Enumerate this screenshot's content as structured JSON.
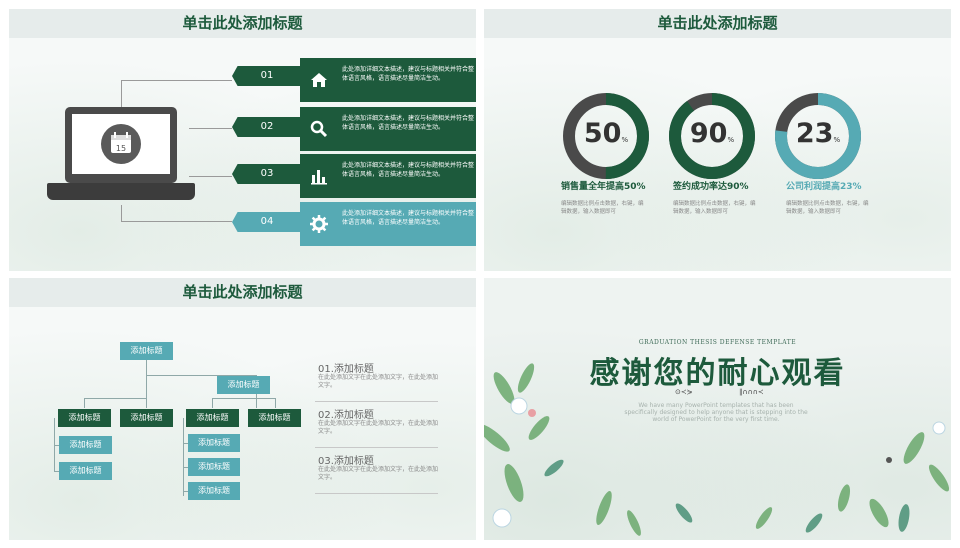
{
  "colors": {
    "dark_green": "#1d5a3c",
    "teal": "#56aab4",
    "gray_ring": "#4a4a4a",
    "title_bg": "#e6eceb"
  },
  "slide1": {
    "title": "单击此处添加标题",
    "laptop": {
      "icon": "calendar-icon",
      "day": "15"
    },
    "items": [
      {
        "num": "01",
        "icon": "house-icon",
        "text": "此处添加详细文本描述，建议与标题相关并符合整体语言风格，语言描述尽量简洁生动。",
        "color": "dark"
      },
      {
        "num": "02",
        "icon": "magnifier-icon",
        "text": "此处添加详细文本描述，建议与标题相关并符合整体语言风格，语言描述尽量简洁生动。",
        "color": "dark"
      },
      {
        "num": "03",
        "icon": "bar-chart-icon",
        "text": "此处添加详细文本描述，建议与标题相关并符合整体语言风格，语言描述尽量简洁生动。",
        "color": "dark"
      },
      {
        "num": "04",
        "icon": "gear-icon",
        "text": "此处添加详细文本描述，建议与标题相关并符合整体语言风格，语言描述尽量简洁生动。",
        "color": "teal"
      }
    ]
  },
  "slide2": {
    "title": "单击此处添加标题",
    "stats": [
      {
        "value": "50",
        "pct": "%",
        "progress": 0.5,
        "ring_color": "#1d5a3c",
        "label": "销售量全年提高50%",
        "desc": "编辑数据比例点击数据，右键，编辑数据，输入数据即可"
      },
      {
        "value": "90",
        "pct": "%",
        "progress": 0.9,
        "ring_color": "#1d5a3c",
        "label": "签约成功率达90%",
        "desc": "编辑数据比例点击数据，右键，编辑数据，输入数据即可"
      },
      {
        "value": "23",
        "pct": "%",
        "progress": 0.77,
        "ring_color": "#56aab4",
        "label": "公司利润提高23%",
        "desc": "编辑数据比例点击数据，右键，编辑数据，输入数据即可"
      }
    ]
  },
  "slide3": {
    "title": "单击此处添加标题",
    "node_label": "添加标题",
    "info": [
      {
        "title": "01.添加标题",
        "text": "在此处添加文字在此处添加文字，在此处添加文字。"
      },
      {
        "title": "02.添加标题",
        "text": "在此处添加文字在此处添加文字，在此处添加文字。"
      },
      {
        "title": "03.添加标题",
        "text": "在此处添加文字在此处添加文字，在此处添加文字。"
      }
    ]
  },
  "slide4": {
    "subtitle": "GRADUATION THESIS DEFENSE TEMPLATE",
    "title": "感谢您的耐心观看",
    "desc": "We have many PowerPoint templates that has been specifically designed to help anyone that is stepping into the world of PowerPoint for the very first time.",
    "mark_left": "⊙≺⋟",
    "mark_right": "∥∩∩∩≺"
  }
}
